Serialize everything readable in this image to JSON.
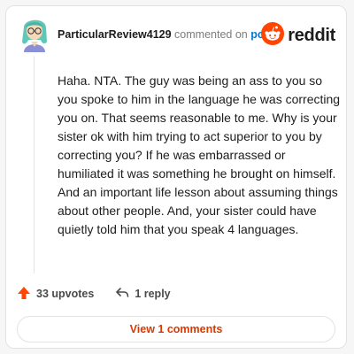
{
  "comment": {
    "username": "ParticularReview4129",
    "commented_text": "commented on",
    "post_link": "post",
    "body": "Haha. NTA. The guy was being an ass to you so you spoke to him in the language he was correcting you on. That seems reasonable to me. Why is your sister ok with him trying to act superior to you by correcting you? If he was embarrassed or humiliated it was something he brought on himself. And an important life lesson about assuming things about other people. And, your sister could have quietly told him that you speak 4 languages."
  },
  "brand": {
    "name": "reddit",
    "icon": "reddit-snoo-icon",
    "color": "#ff4500"
  },
  "avatar": {
    "icon": "user-avatar-icon"
  },
  "actions": {
    "upvotes": "33 upvotes",
    "upvote_icon": "upvote-arrow-icon",
    "upvote_color": "#ff4500",
    "replies": "1 reply",
    "reply_icon": "reply-arrow-icon"
  },
  "view_comments": {
    "label": "View 1 comments",
    "color": "#d93a00"
  }
}
